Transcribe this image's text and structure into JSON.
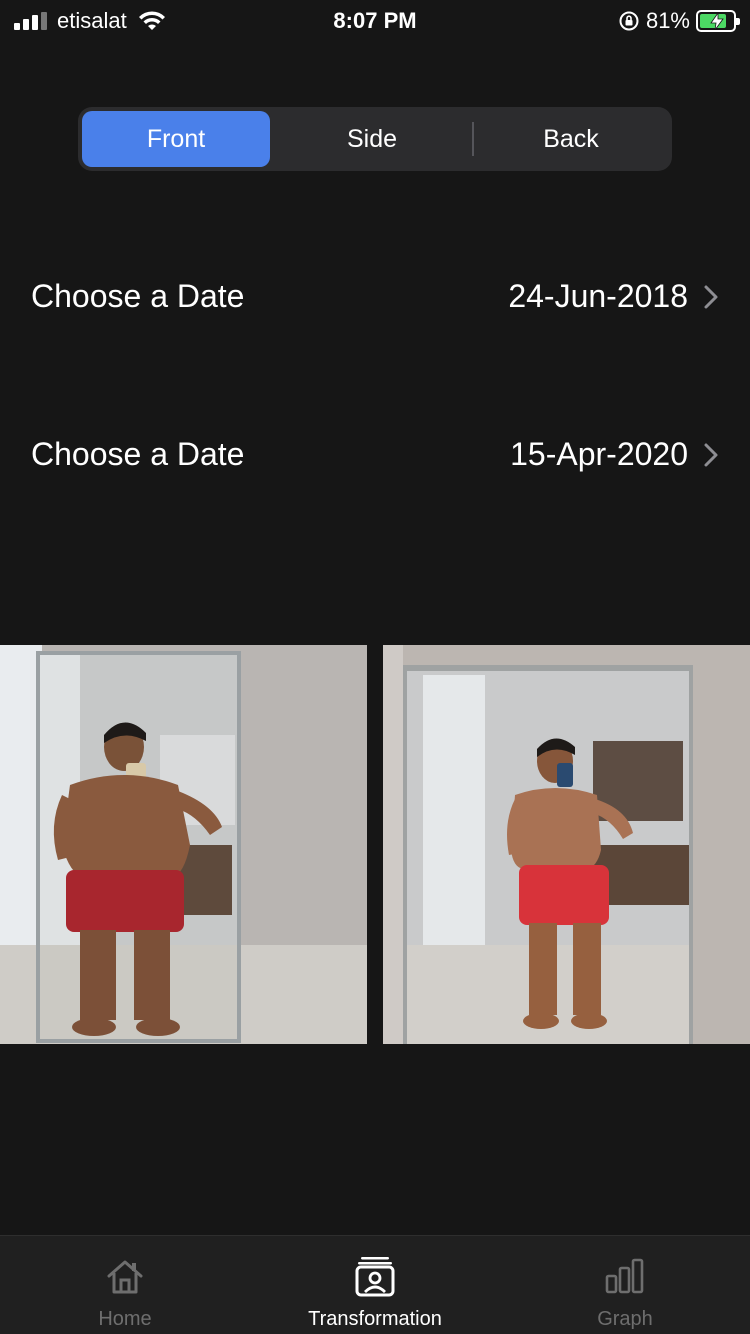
{
  "status_bar": {
    "carrier": "etisalat",
    "time": "8:07 PM",
    "battery_percent": "81%",
    "battery_level": 0.81,
    "icons": [
      "cellular-signal-icon",
      "wifi-icon",
      "orientation-lock-icon",
      "battery-charging-icon"
    ]
  },
  "segments": {
    "front": "Front",
    "side": "Side",
    "back": "Back",
    "selected": "Front",
    "accent_color": "#4a80ea"
  },
  "dates": [
    {
      "label": "Choose a Date",
      "value": "24-Jun-2018"
    },
    {
      "label": "Choose a Date",
      "value": "15-Apr-2020"
    }
  ],
  "photos": [
    {
      "alt": "before-photo"
    },
    {
      "alt": "after-photo"
    }
  ],
  "tab_bar": {
    "items": [
      {
        "label": "Home",
        "icon": "home-icon",
        "active": false
      },
      {
        "label": "Transformation",
        "icon": "portrait-stack-icon",
        "active": true
      },
      {
        "label": "Graph",
        "icon": "bar-chart-icon",
        "active": false
      }
    ]
  }
}
